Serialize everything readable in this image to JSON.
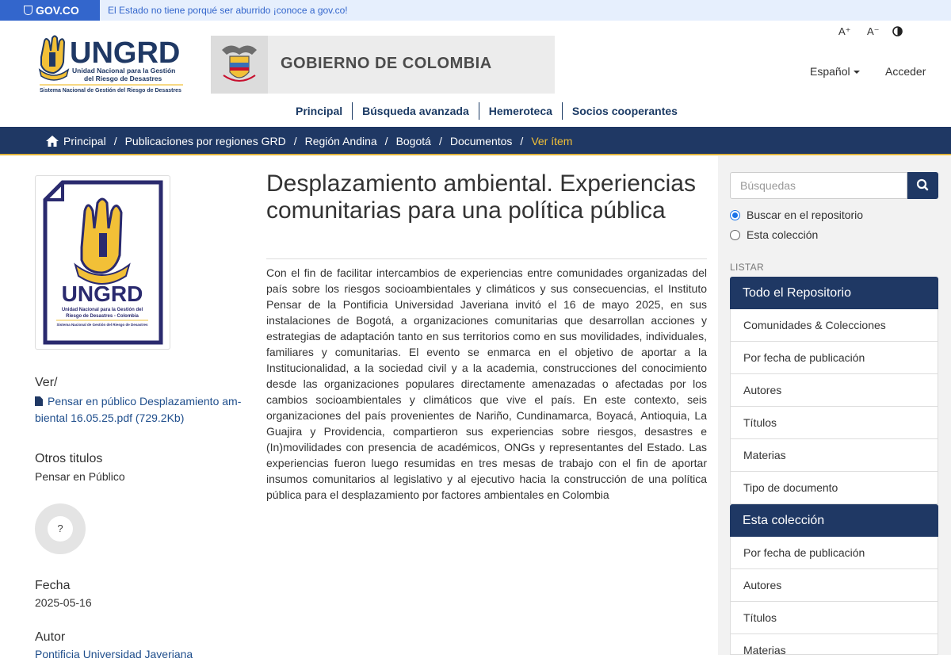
{
  "gov_bar": {
    "logo_text": "GOV.CO",
    "message": "El Estado no tiene porqué ser aburrido ¡conoce a gov.co!"
  },
  "header": {
    "logo_name": "UNGRD",
    "logo_line1": "Unidad Nacional para la Gestión",
    "logo_line2": "del Riesgo de Desastres",
    "logo_sub": "Sistema Nacional de Gestión del Riesgo de Desastres",
    "gov_banner": "GOBIERNO DE COLOMBIA",
    "font_increase": "A⁺",
    "font_decrease": "A⁻",
    "contrast_icon": "contrast-icon",
    "language": "Español",
    "login": "Acceder"
  },
  "main_nav": [
    "Principal",
    "Búsqueda avanzada",
    "Hemeroteca",
    "Socios cooperantes"
  ],
  "breadcrumb": {
    "items": [
      "Principal",
      "Publicaciones por regiones GRD",
      "Región Andina",
      "Bogotá",
      "Documentos"
    ],
    "current": "Ver ítem"
  },
  "thumbnail": {
    "name": "UNGRD",
    "line1": "Unidad Nacional para la Gestión del",
    "line2": "Riesgo de Desastres - Colombia",
    "sub": "Sistema Nacional de Gestión del Riesgo de Desastres"
  },
  "item": {
    "title": "Desplazamiento ambiental. Experiencias comunitarias para una política pública",
    "abstract": "Con el fin de facilitar intercambios de experiencias entre comunidades organizadas del país sobre los riesgos socioambientales y climáticos y sus consecuencias, el Instituto Pensar de la Pontificia Universidad Javeriana invitó el 16 de mayo 2025, en sus instalaciones de Bogotá, a organizaciones comunitarias que desarrollan acciones y estrategias de adaptación tanto en sus territorios como en sus movilidades, individuales, familiares y comunitarias. El evento se enmarca en el objetivo de aportar a la Institucionalidad, a la sociedad civil y a la academia, construcciones del conocimiento desde las organizaciones populares directamente amenazadas o afectadas por los cambios socioambientales y climáticos que vive el país. En este contexto, seis organizaciones del país provenientes de Nariño, Cundinamarca, Boyacá, Antioquia, La Guajira y Providencia, compartieron sus experiencias sobre riesgos, desastres e (In)movilidades con presencia de académicos, ONGs y representantes del Estado. Las experiencias fueron luego resumidas en tres mesas de trabajo con el fin de aportar insumos comunitarios al legislativo y al ejecutivo hacia la construcción de una política pública para el desplazamiento por factores ambientales en Colombia",
    "view_label": "Ver/",
    "file_link": "Pensar en público Desplazamiento am-biental 16.05.25.pdf (729.2Kb)",
    "other_titles_label": "Otros titulos",
    "other_titles": "Pensar en Público",
    "altmetric": "?",
    "date_label": "Fecha",
    "date": "2025-05-16",
    "author_label": "Autor",
    "author": "Pontificia Universidad Javeriana"
  },
  "sidebar": {
    "search_placeholder": "Búsquedas",
    "radio_repo": "Buscar en el repositorio",
    "radio_collection": "Esta colección",
    "listar": "LISTAR",
    "repo_heading": "Todo el Repositorio",
    "repo_items": [
      "Comunidades & Colecciones",
      "Por fecha de publicación",
      "Autores",
      "Títulos",
      "Materias",
      "Tipo de documento"
    ],
    "collection_heading": "Esta colección",
    "collection_items": [
      "Por fecha de publicación",
      "Autores",
      "Títulos",
      "Materias"
    ]
  },
  "colors": {
    "navy": "#1f3864",
    "gold": "#f2c037",
    "gov_blue": "#3366cc"
  }
}
